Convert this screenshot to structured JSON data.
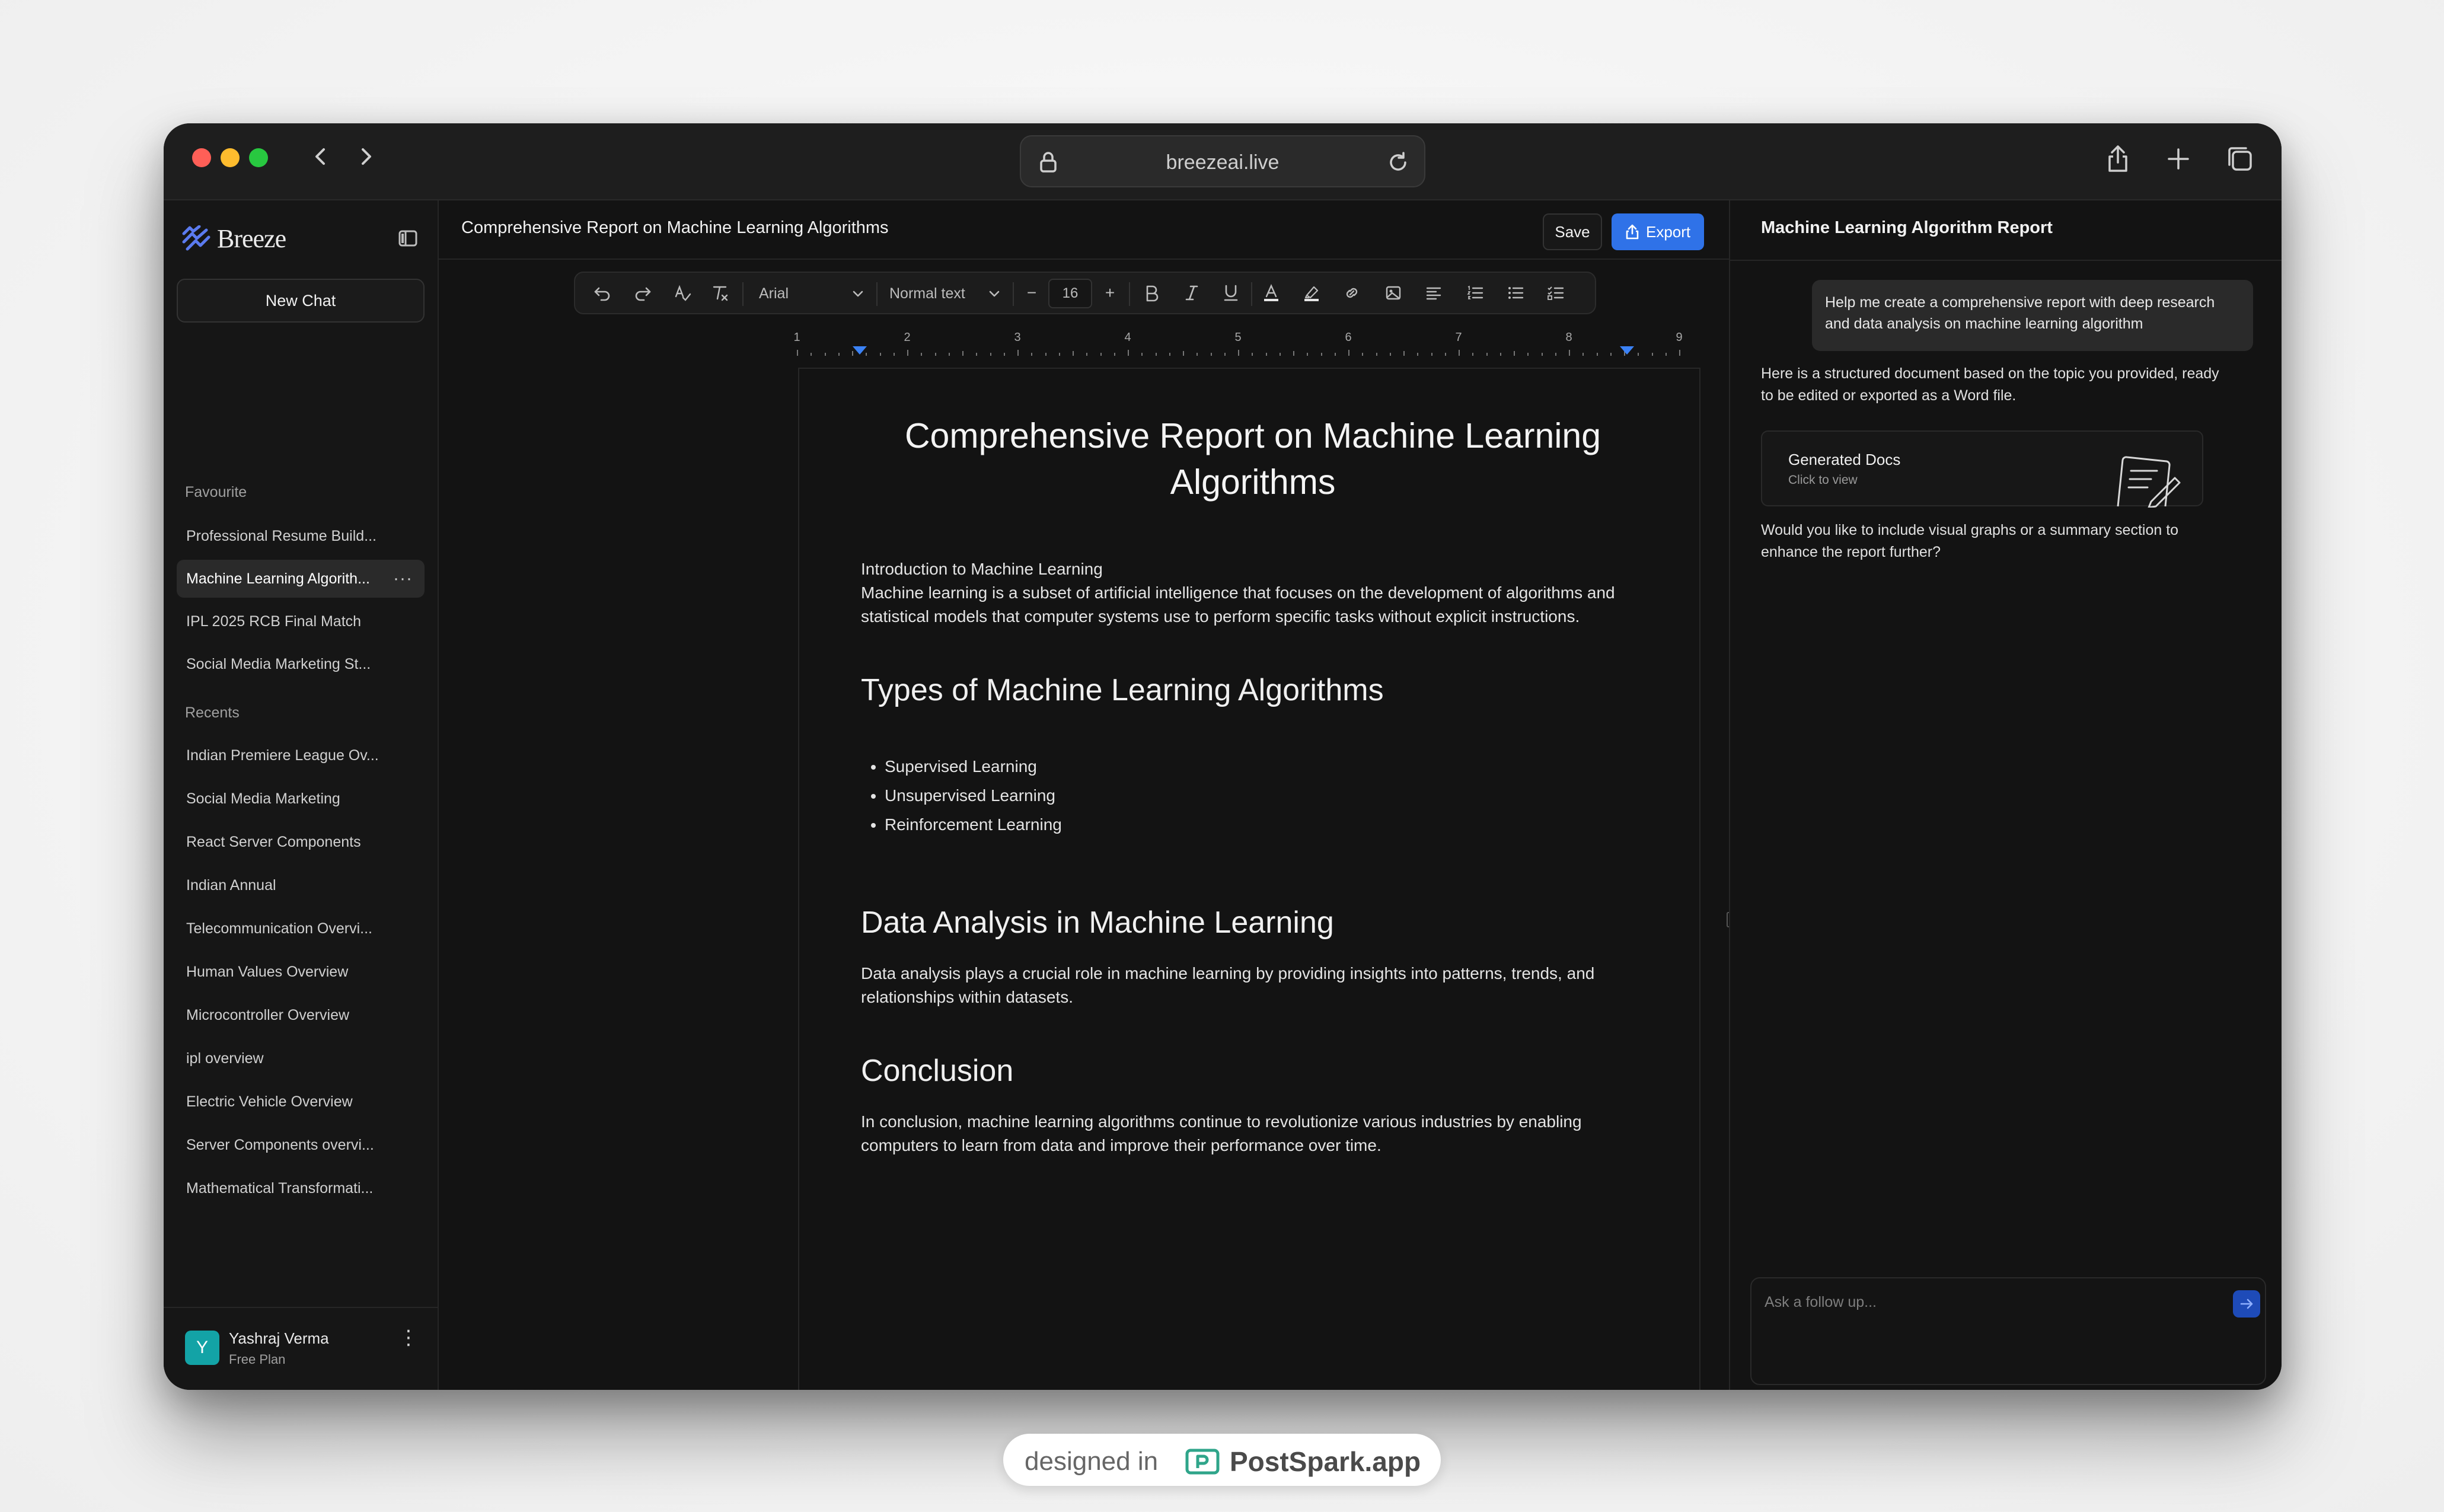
{
  "browser": {
    "url": "breezeai.live"
  },
  "sidebar": {
    "logo_text": "Breeze",
    "new_chat": "New Chat",
    "favourite_label": "Favourite",
    "favourites": [
      "Professional Resume Build...",
      "Machine Learning Algorith...",
      "IPL 2025 RCB Final Match",
      "Social Media Marketing St..."
    ],
    "recents_label": "Recents",
    "recents": [
      "Indian Premiere League Ov...",
      "Social Media Marketing",
      "React Server Components",
      "Indian Annual",
      "Telecommunication Overvi...",
      "Human Values Overview",
      "Microcontroller Overview",
      "ipl overview",
      "Electric Vehicle Overview",
      "Server Components overvi...",
      "Mathematical Transformati..."
    ],
    "active_more": "···",
    "user": {
      "initial": "Y",
      "name": "Yashraj Verma",
      "plan": "Free Plan",
      "menu": "⋮"
    }
  },
  "editor": {
    "title": "Comprehensive Report on Machine Learning Algorithms",
    "save_label": "Save",
    "export_label": "Export",
    "toolbar": {
      "font": "Arial",
      "style": "Normal text",
      "size": "16",
      "minus": "−",
      "plus": "+"
    },
    "ruler_numbers": [
      "1",
      "2",
      "3",
      "4",
      "5",
      "6",
      "7",
      "8",
      "9"
    ],
    "document": {
      "heading": "Comprehensive Report on Machine Learning Algorithms",
      "intro_title": "Introduction to Machine Learning",
      "intro_body": "Machine learning is a subset of artificial intelligence that focuses on the development of algorithms and statistical models that computer systems use to perform specific tasks without explicit instructions.",
      "types_heading": "Types of Machine Learning Algorithms",
      "types": [
        "Supervised Learning",
        "Unsupervised Learning",
        "Reinforcement Learning"
      ],
      "analysis_heading": "Data Analysis in Machine Learning",
      "analysis_body": "Data analysis plays a crucial role in machine learning by providing insights into patterns, trends, and relationships within datasets.",
      "conclusion_heading": "Conclusion",
      "conclusion_body": "In conclusion, machine learning algorithms continue to revolutionize various industries by enabling computers to learn from data and improve their performance over time."
    }
  },
  "chat": {
    "title": "Machine Learning Algorithm Report",
    "user_message": "Help me create a comprehensive report with deep research and data analysis on machine learning algorithm",
    "bot_message_1": "Here is a structured document based on the topic you provided, ready to be edited or exported as a Word file.",
    "card_title": "Generated Docs",
    "card_subtitle": "Click to view",
    "bot_message_2": "Would you like to include visual graphs or a summary section to enhance the report further?",
    "input_placeholder": "Ask a follow up..."
  },
  "footer": {
    "designed_in": "designed in",
    "brand": "PostSpark.app"
  },
  "colors": {
    "accent": "#2f72e8",
    "avatar": "#13a3a6",
    "send": "#1e4bb8"
  }
}
